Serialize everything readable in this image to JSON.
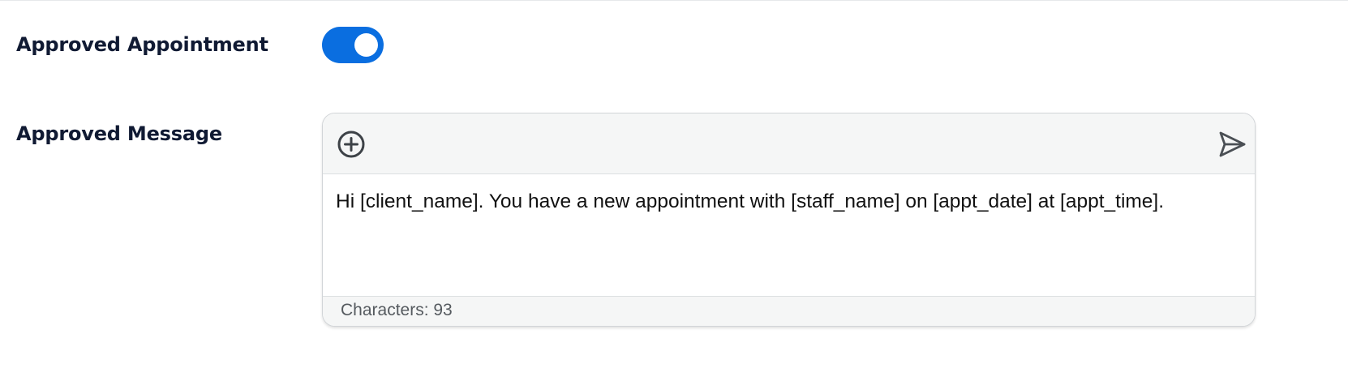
{
  "settings": {
    "approved_appointment": {
      "label": "Approved Appointment",
      "toggle_on": true,
      "toggle_color": "#0a6ee0"
    },
    "approved_message": {
      "label": "Approved Message",
      "toolbar": {
        "left_icon": "plus-circle-icon",
        "right_icon": "send-icon"
      },
      "body_text": "Hi [client_name]. You have a new appointment with [staff_name] on [appt_date] at [appt_time].",
      "footer_label": "Characters: 93"
    }
  }
}
